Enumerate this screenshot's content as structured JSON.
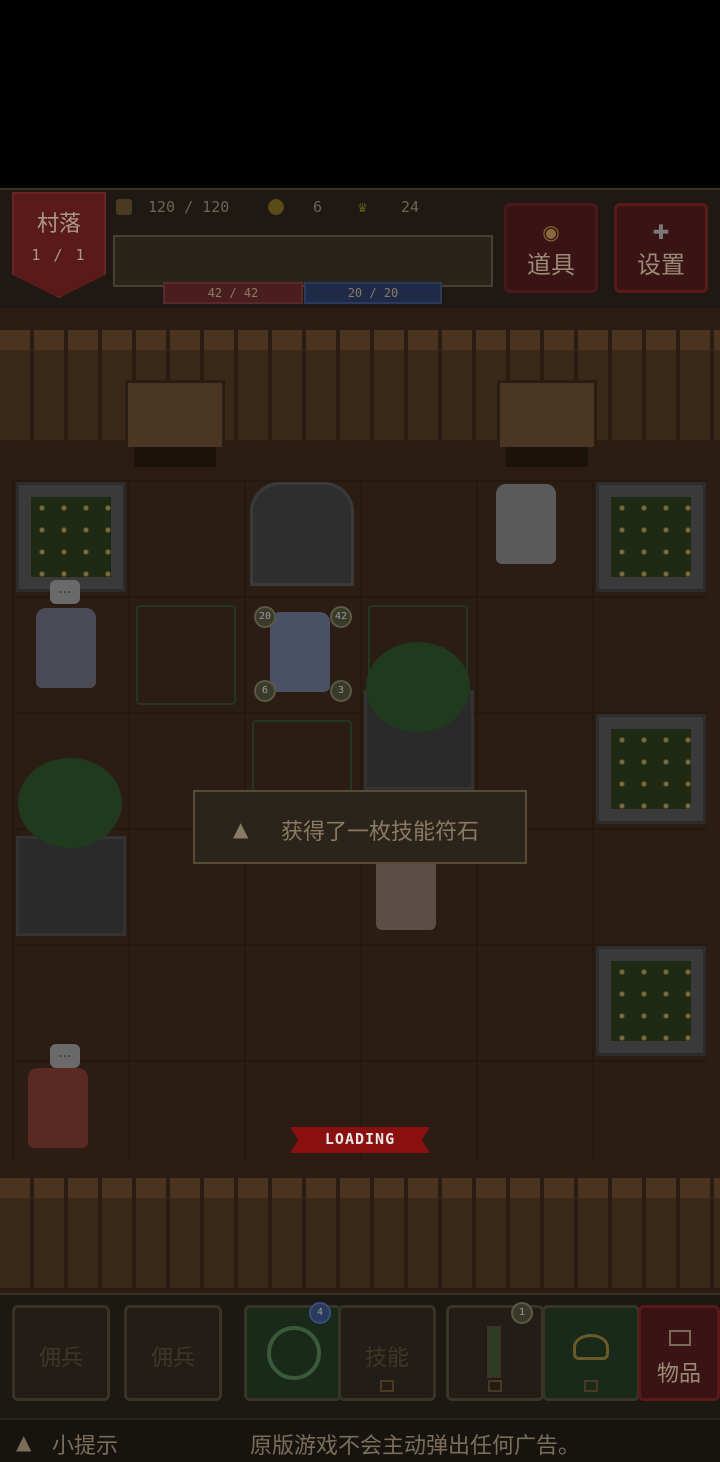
{
  "header": {
    "location": "村落",
    "location_floor": "1 / 1",
    "food": "120 / 120",
    "coins": "6",
    "crowns": "24",
    "hp": "42 / 42",
    "mp": "20 / 20",
    "items_button": "道具",
    "settings_button": "设置"
  },
  "field": {
    "notification": "获得了一枚技能符石",
    "loading": "LOADING",
    "hero_badges": {
      "attack": "20",
      "hp": "42",
      "left": "6",
      "right": "3"
    },
    "speech_bubble": "..."
  },
  "bottom": {
    "slots": [
      "佣兵",
      "佣兵",
      "",
      "技能",
      "",
      "",
      "物品"
    ],
    "skill_badge": "4",
    "potion_badge": "1"
  },
  "hint": {
    "label": "小提示",
    "text": "原版游戏不会主动弹出任何广告。"
  },
  "colors": {
    "background": "#000000",
    "ground": "#2b1d14",
    "banner_red": "#5a1a1a",
    "hp_red": "#4a1e1e",
    "mp_blue": "#1e2a48",
    "loading_red": "#8a1010"
  },
  "icons": [
    "food-icon",
    "coin-icon",
    "crown-icon",
    "wrench-icon",
    "items-icon",
    "warning-icon",
    "chest-icon"
  ]
}
